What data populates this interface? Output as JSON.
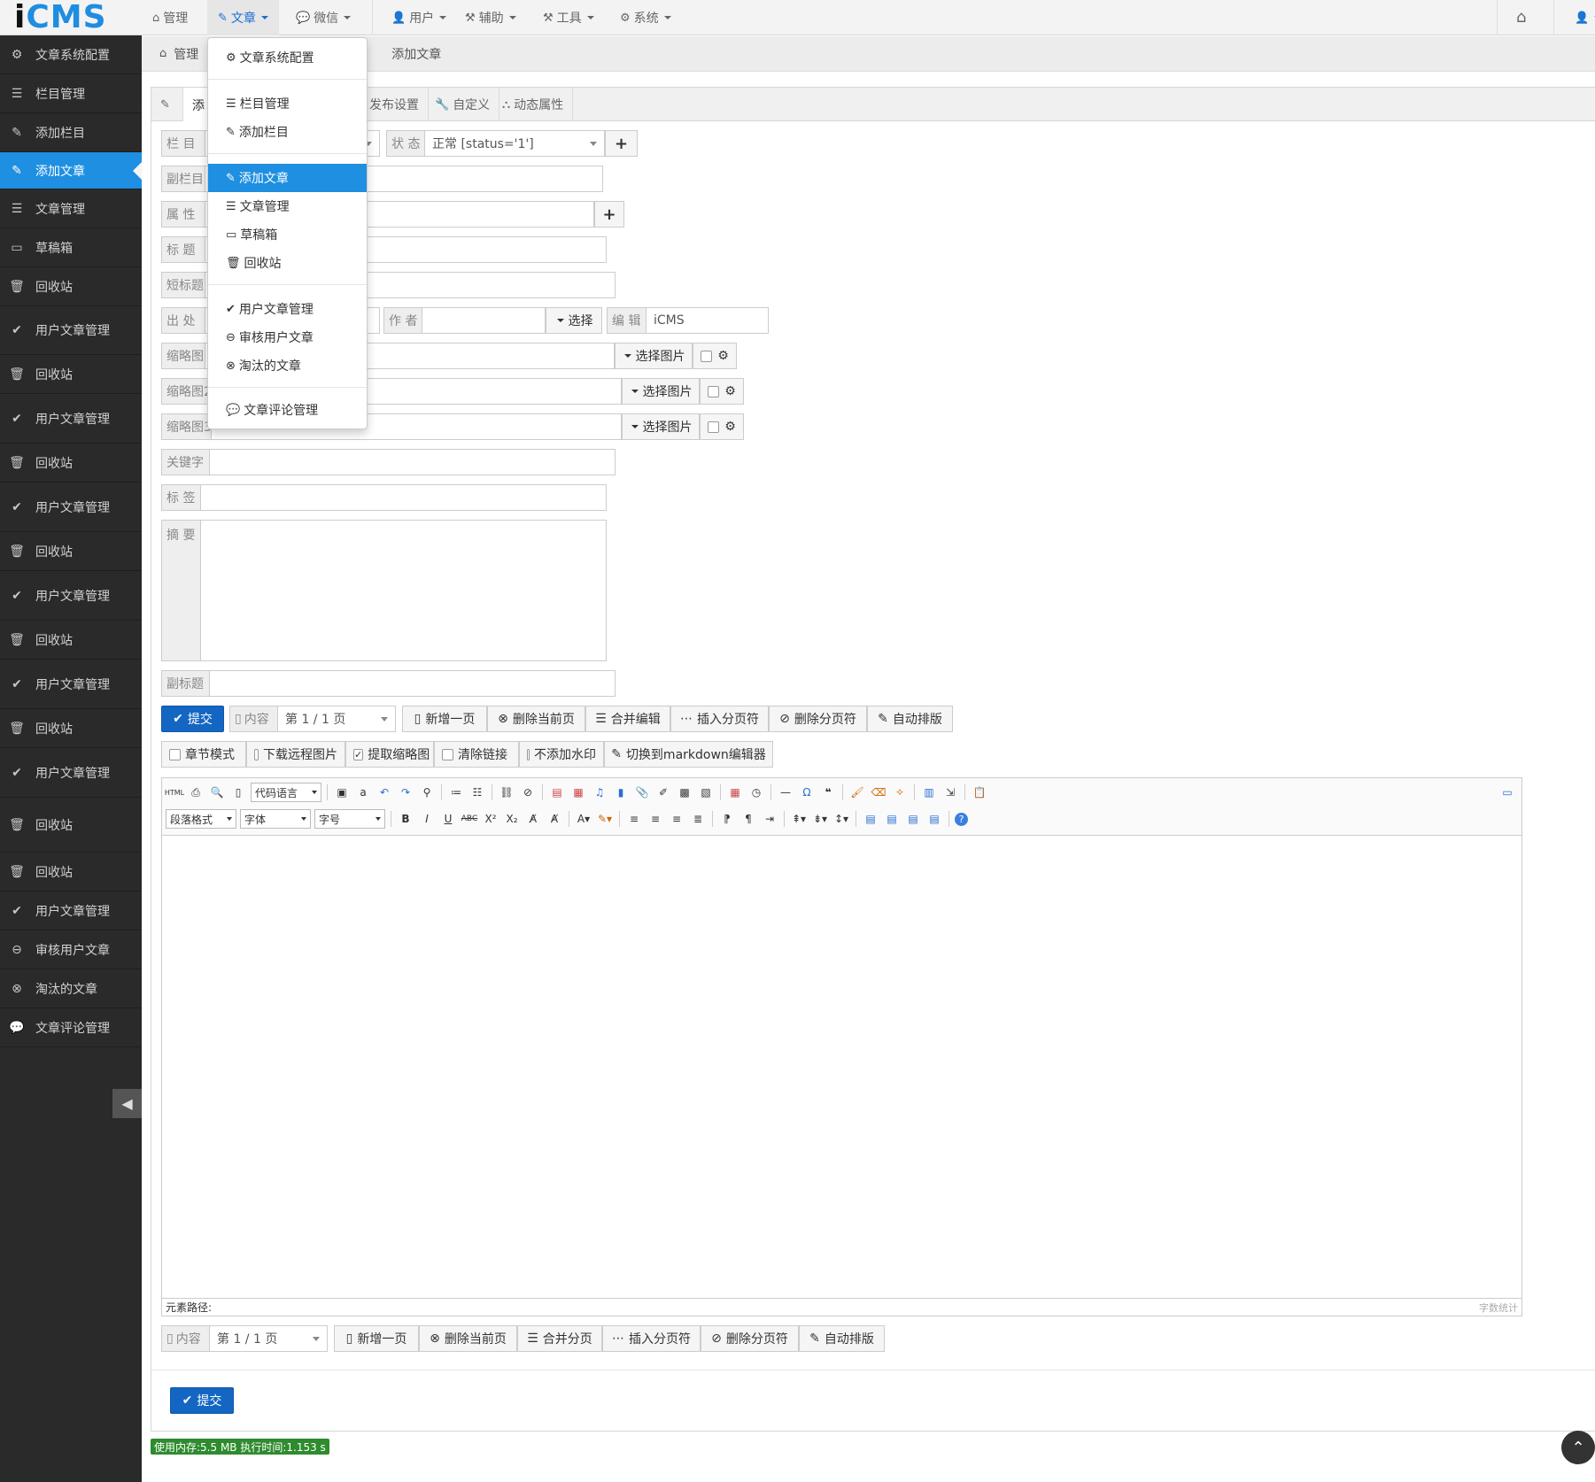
{
  "app": {
    "logo_i": "i",
    "logo_cms": "CMS"
  },
  "topnav": {
    "items": [
      {
        "label": "管理",
        "icon": "home-icon"
      },
      {
        "label": "文章",
        "icon": "edit-icon"
      },
      {
        "label": "微信",
        "icon": "wechat-icon"
      },
      {
        "label": "用户",
        "icon": "user-icon"
      },
      {
        "label": "辅助",
        "icon": "gavel-icon"
      },
      {
        "label": "工具",
        "icon": "gavel-icon"
      },
      {
        "label": "系统",
        "icon": "gear-icon"
      }
    ]
  },
  "sidebar": {
    "items": [
      {
        "label": "文章系统配置",
        "icon": "gear-icon"
      },
      {
        "label": "栏目管理",
        "icon": "list-icon"
      },
      {
        "label": "添加栏目",
        "icon": "edit-icon"
      },
      {
        "label": "添加文章",
        "icon": "edit-icon",
        "active": true
      },
      {
        "label": "文章管理",
        "icon": "list-icon"
      },
      {
        "label": "草稿箱",
        "icon": "inbox-icon"
      },
      {
        "label": "回收站",
        "icon": "trash-icon"
      },
      {
        "label": "用户文章管理",
        "icon": "check-circle-icon"
      },
      {
        "label": "回收站",
        "icon": "trash-icon"
      },
      {
        "label": "用户文章管理",
        "icon": "check-circle-icon"
      },
      {
        "label": "回收站",
        "icon": "trash-icon"
      },
      {
        "label": "用户文章管理",
        "icon": "check-circle-icon"
      },
      {
        "label": "回收站",
        "icon": "trash-icon"
      },
      {
        "label": "用户文章管理",
        "icon": "check-circle-icon"
      },
      {
        "label": "回收站",
        "icon": "trash-icon"
      },
      {
        "label": "用户文章管理",
        "icon": "check-circle-icon"
      },
      {
        "label": "回收站",
        "icon": "trash-icon"
      },
      {
        "label": "用户文章管理",
        "icon": "check-circle-icon"
      },
      {
        "label": "回收站",
        "icon": "trash-icon"
      },
      {
        "label": "回收站",
        "icon": "trash-icon"
      },
      {
        "label": "用户文章管理",
        "icon": "check-circle-icon"
      },
      {
        "label": "审核用户文章",
        "icon": "minus-circle-icon"
      },
      {
        "label": "淘汰的文章",
        "icon": "times-circle-icon"
      },
      {
        "label": "文章评论管理",
        "icon": "comments-icon"
      }
    ]
  },
  "breadcrumb": {
    "home": "管理",
    "current": "添加文章"
  },
  "tabs": [
    {
      "label": "添"
    },
    {
      "label": "发布设置"
    },
    {
      "label": "自定义"
    },
    {
      "label": "动态属性"
    }
  ],
  "form": {
    "category": "栏 目",
    "status_label": "状 态",
    "status_value": "正常 [status='1']",
    "sub_category": "副栏目",
    "attr": "属 性",
    "title": "标 题",
    "short_title": "短标题",
    "source": "出 处",
    "author": "作 者",
    "choose": "选择",
    "editor_label": "编 辑",
    "editor_value": "iCMS",
    "thumb1": "缩略图",
    "thumb2": "缩略图2",
    "thumb3": "缩略图3",
    "choose_image": "选择图片",
    "keywords": "关键字",
    "tags": "标 签",
    "summary": "摘 要",
    "subtitle": "副标题"
  },
  "actions": {
    "submit": "提交",
    "content": "内容",
    "page": "第 1 / 1 页",
    "new_page": "新增一页",
    "delete_page": "删除当前页",
    "merge_edit": "合并编辑",
    "insert_break": "插入分页符",
    "delete_break": "删除分页符",
    "auto_format": "自动排版",
    "merge_pages": "合并分页"
  },
  "options": {
    "chapter": "章节模式",
    "remote_images": "下载远程图片",
    "extract_thumb": "提取缩略图",
    "clear_links": "清除链接",
    "no_watermark": "不添加水印",
    "markdown": "切换到markdown编辑器"
  },
  "editor": {
    "code_lang": "代码语言",
    "para": "段落格式",
    "font": "字体",
    "size": "字号",
    "path": "元素路径:",
    "count": "字数统计"
  },
  "dropdown": {
    "items": [
      {
        "label": "文章系统配置",
        "icon": "gear-icon"
      },
      {
        "label": "栏目管理",
        "icon": "list-icon"
      },
      {
        "label": "添加栏目",
        "icon": "edit-icon"
      },
      {
        "label": "添加文章",
        "icon": "edit-icon"
      },
      {
        "label": "文章管理",
        "icon": "list-icon"
      },
      {
        "label": "草稿箱",
        "icon": "inbox-icon"
      },
      {
        "label": "回收站",
        "icon": "trash-icon"
      },
      {
        "label": "用户文章管理",
        "icon": "check-circle-icon"
      },
      {
        "label": "审核用户文章",
        "icon": "minus-circle-icon"
      },
      {
        "label": "淘汰的文章",
        "icon": "times-circle-icon"
      },
      {
        "label": "文章评论管理",
        "icon": "comments-icon"
      }
    ]
  },
  "footer": {
    "memory": "使用内存:5.5 MB 执行时间:1.153 s"
  },
  "colors": {
    "accent": "#1e8fe1",
    "primary": "#1466c3",
    "sidebar": "#2a2a2a"
  }
}
